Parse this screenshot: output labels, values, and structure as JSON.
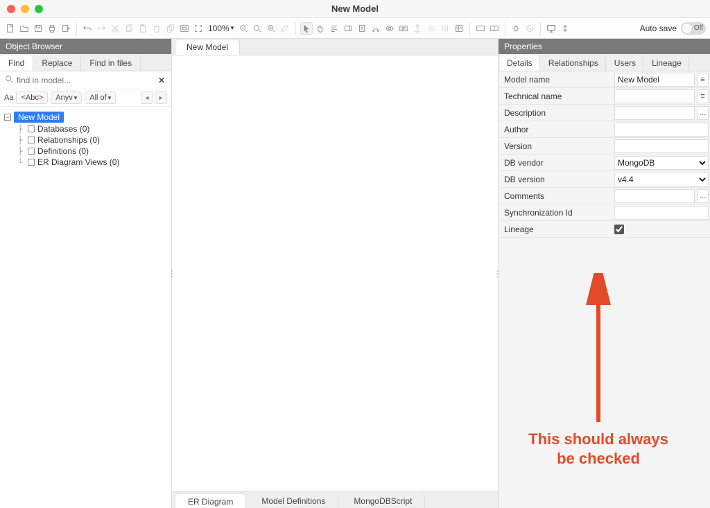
{
  "window": {
    "title": "New Model"
  },
  "toolbar": {
    "zoom": "100%",
    "autosave_label": "Auto save",
    "autosave_state": "Off"
  },
  "object_browser": {
    "title": "Object Browser",
    "tabs": {
      "find": "Find",
      "replace": "Replace",
      "find_in_files": "Find in files"
    },
    "search_placeholder": "find in model...",
    "filters": {
      "aa": "Aa",
      "abc": "<Abc>",
      "anyv": "Anyv",
      "allof": "All of"
    },
    "tree_root": "New Model",
    "tree_children": [
      "Databases (0)",
      "Relationships (0)",
      "Definitions (0)",
      "ER Diagram Views (0)"
    ]
  },
  "editor": {
    "tab": "New Model",
    "bottom_tabs": [
      "ER Diagram",
      "Model Definitions",
      "MongoDBScript"
    ]
  },
  "properties": {
    "title": "Properties",
    "tabs": [
      "Details",
      "Relationships",
      "Users",
      "Lineage"
    ],
    "rows": {
      "model_name": {
        "label": "Model name",
        "value": "New Model"
      },
      "technical_name": {
        "label": "Technical name",
        "value": ""
      },
      "description": {
        "label": "Description",
        "value": ""
      },
      "author": {
        "label": "Author",
        "value": ""
      },
      "version": {
        "label": "Version",
        "value": ""
      },
      "db_vendor": {
        "label": "DB vendor",
        "value": "MongoDB"
      },
      "db_version": {
        "label": "DB version",
        "value": "v4.4"
      },
      "comments": {
        "label": "Comments",
        "value": ""
      },
      "sync_id": {
        "label": "Synchronization Id",
        "value": ""
      },
      "lineage": {
        "label": "Lineage",
        "checked": true
      }
    }
  },
  "annotation": {
    "text_line1": "This should always",
    "text_line2": "be checked"
  }
}
